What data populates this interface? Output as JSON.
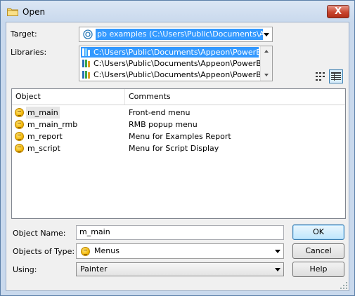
{
  "window": {
    "title": "Open",
    "close_label": "X"
  },
  "target": {
    "label": "Target:",
    "value": "pb examples (C:\\Users\\Public\\Documents\\Appeo"
  },
  "libraries": {
    "label": "Libraries:",
    "items": [
      {
        "path": "C:\\Users\\Public\\Documents\\Appeon\\PowerBuilde",
        "selected": true
      },
      {
        "path": "C:\\Users\\Public\\Documents\\Appeon\\PowerBuilde",
        "selected": false
      },
      {
        "path": "C:\\Users\\Public\\Documents\\Appeon\\PowerBuilde",
        "selected": false
      }
    ]
  },
  "objects_list": {
    "columns": [
      "Object",
      "Comments"
    ],
    "rows": [
      {
        "name": "m_main",
        "comment": "Front-end menu",
        "selected": true
      },
      {
        "name": "m_main_rmb",
        "comment": "RMB popup menu",
        "selected": false
      },
      {
        "name": "m_report",
        "comment": "Menu for Examples Report",
        "selected": false
      },
      {
        "name": "m_script",
        "comment": "Menu for Script Display",
        "selected": false
      }
    ]
  },
  "object_name": {
    "label": "Object Name:",
    "value": "m_main"
  },
  "objects_of_type": {
    "label": "Objects of Type:",
    "value": "Menus"
  },
  "using": {
    "label": "Using:",
    "value": "Painter"
  },
  "buttons": {
    "ok": "OK",
    "cancel": "Cancel",
    "help": "Help"
  },
  "colors": {
    "selection": "#3399ff",
    "frame": "#c9d9ed",
    "close": "#c9452f"
  }
}
